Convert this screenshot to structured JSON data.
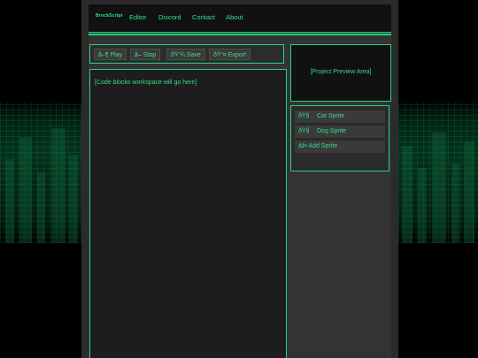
{
  "nav": {
    "brand": "BrockScript",
    "links": [
      "Editor",
      "Discord",
      "Contact",
      "About"
    ]
  },
  "toolbar": {
    "play": "â–¶ Play",
    "stop": "â–  Stop",
    "save": "ðŸ’¾ Save",
    "export": "ðŸ“¤ Export"
  },
  "preview": {
    "placeholder": "[Project Preview Area]"
  },
  "workspace": {
    "placeholder": "[Code blocks workspace will go here]"
  },
  "sprites": {
    "items": [
      {
        "icon": "ðŸ§",
        "label": "Cat Sprite"
      },
      {
        "icon": "ðŸ§",
        "label": "Dog Sprite"
      }
    ],
    "add": "âž• Add Sprite"
  },
  "colors": {
    "accent": "#29d27f",
    "text": "#39dd89",
    "panel": "#2b2b2b"
  }
}
